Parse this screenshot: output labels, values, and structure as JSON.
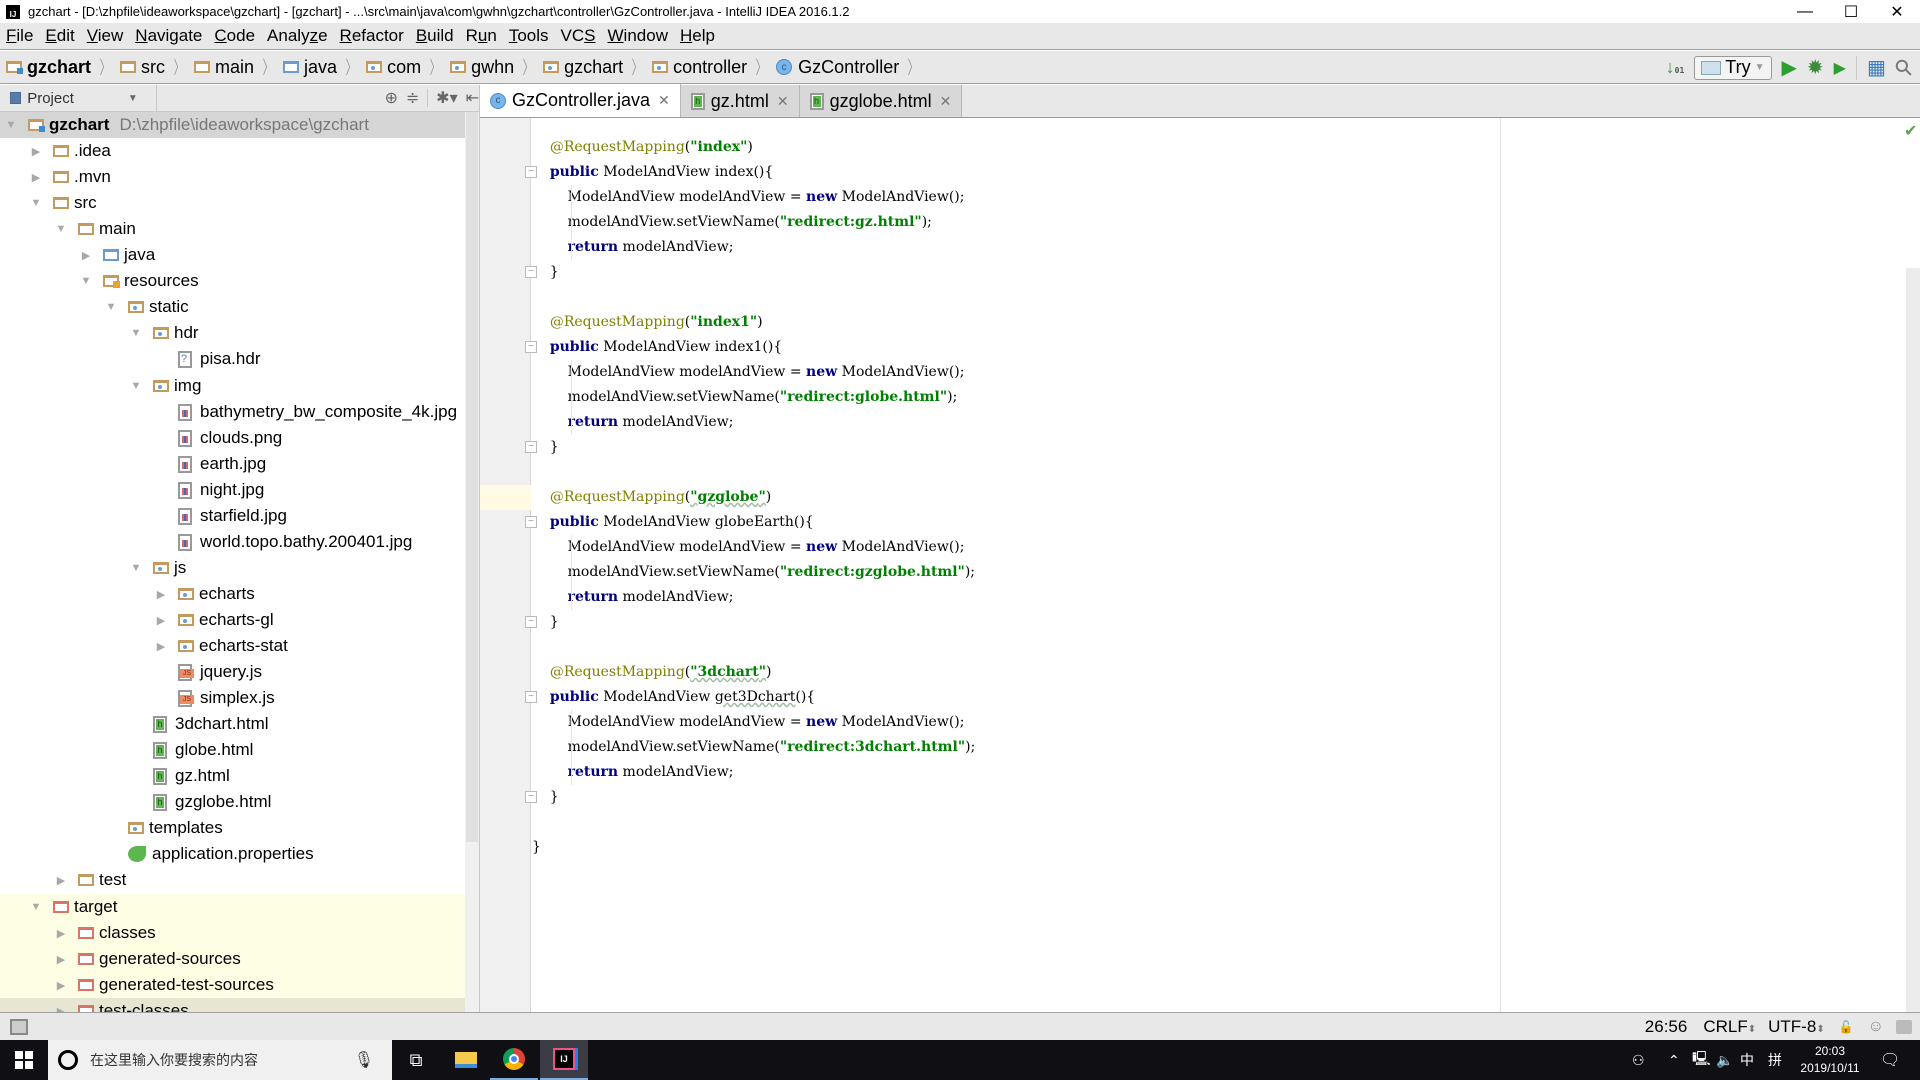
{
  "window": {
    "title": "gzchart - [D:\\zhpfile\\ideaworkspace\\gzchart] - [gzchart] - ...\\src\\main\\java\\com\\gwhn\\gzchart\\controller\\GzController.java - IntelliJ IDEA 2016.1.2",
    "app_icon": "IJ",
    "minimize_glyph": "—",
    "maximize_glyph": "☐",
    "close_glyph": "✕"
  },
  "menu": [
    {
      "u": "F",
      "rest": "ile"
    },
    {
      "u": "E",
      "rest": "dit"
    },
    {
      "u": "V",
      "rest": "iew"
    },
    {
      "u": "N",
      "rest": "avigate"
    },
    {
      "u": "C",
      "rest": "ode"
    },
    {
      "pre": "Analy",
      "u": "z",
      "rest": "e"
    },
    {
      "u": "R",
      "rest": "efactor"
    },
    {
      "u": "B",
      "rest": "uild"
    },
    {
      "pre": "R",
      "u": "u",
      "rest": "n"
    },
    {
      "u": "T",
      "rest": "ools"
    },
    {
      "pre": "VC",
      "u": "S",
      "rest": ""
    },
    {
      "u": "W",
      "rest": "indow"
    },
    {
      "u": "H",
      "rest": "elp"
    }
  ],
  "breadcrumb": [
    "gzchart",
    "src",
    "main",
    "java",
    "com",
    "gwhn",
    "gzchart",
    "controller",
    "GzController"
  ],
  "toolbar": {
    "run_config": "Try",
    "run_icon": "▶",
    "debug_icon": "✹",
    "coverage_icon": "▶",
    "structure_icon": "▦",
    "search_icon": "⚲"
  },
  "project_panel": {
    "title": "Project",
    "root_name": "gzchart",
    "root_path": "D:\\zhpfile\\ideaworkspace\\gzchart",
    "items": [
      {
        "label": ".idea",
        "depth": 1,
        "type": "folder",
        "expanded": false
      },
      {
        "label": ".mvn",
        "depth": 1,
        "type": "folder",
        "expanded": false
      },
      {
        "label": "src",
        "depth": 1,
        "type": "folder",
        "expanded": true
      },
      {
        "label": "main",
        "depth": 2,
        "type": "folder",
        "expanded": true
      },
      {
        "label": "java",
        "depth": 3,
        "type": "folder-source",
        "expanded": false
      },
      {
        "label": "resources",
        "depth": 3,
        "type": "folder-resources",
        "expanded": true
      },
      {
        "label": "static",
        "depth": 4,
        "type": "folder-package",
        "expanded": true
      },
      {
        "label": "hdr",
        "depth": 5,
        "type": "folder-package",
        "expanded": true
      },
      {
        "label": "pisa.hdr",
        "depth": 6,
        "type": "file-unknown"
      },
      {
        "label": "img",
        "depth": 5,
        "type": "folder-package",
        "expanded": true
      },
      {
        "label": "bathymetry_bw_composite_4k.jpg",
        "depth": 6,
        "type": "file-image"
      },
      {
        "label": "clouds.png",
        "depth": 6,
        "type": "file-image"
      },
      {
        "label": "earth.jpg",
        "depth": 6,
        "type": "file-image"
      },
      {
        "label": "night.jpg",
        "depth": 6,
        "type": "file-image"
      },
      {
        "label": "starfield.jpg",
        "depth": 6,
        "type": "file-image"
      },
      {
        "label": "world.topo.bathy.200401.jpg",
        "depth": 6,
        "type": "file-image"
      },
      {
        "label": "js",
        "depth": 5,
        "type": "folder-package",
        "expanded": true
      },
      {
        "label": "echarts",
        "depth": 6,
        "type": "folder-package",
        "expanded": false
      },
      {
        "label": "echarts-gl",
        "depth": 6,
        "type": "folder-package",
        "expanded": false
      },
      {
        "label": "echarts-stat",
        "depth": 6,
        "type": "folder-package",
        "expanded": false
      },
      {
        "label": "jquery.js",
        "depth": 6,
        "type": "file-js"
      },
      {
        "label": "simplex.js",
        "depth": 6,
        "type": "file-js"
      },
      {
        "label": "3dchart.html",
        "depth": 5,
        "type": "file-html"
      },
      {
        "label": "globe.html",
        "depth": 5,
        "type": "file-html"
      },
      {
        "label": "gz.html",
        "depth": 5,
        "type": "file-html"
      },
      {
        "label": "gzglobe.html",
        "depth": 5,
        "type": "file-html"
      },
      {
        "label": "templates",
        "depth": 4,
        "type": "folder-package"
      },
      {
        "label": "application.properties",
        "depth": 4,
        "type": "file-spring"
      },
      {
        "label": "test",
        "depth": 2,
        "type": "folder",
        "expanded": false
      },
      {
        "label": "target",
        "depth": 1,
        "type": "folder-excluded",
        "expanded": true
      },
      {
        "label": "classes",
        "depth": 2,
        "type": "folder-excluded",
        "expanded": false
      },
      {
        "label": "generated-sources",
        "depth": 2,
        "type": "folder-excluded",
        "expanded": false
      },
      {
        "label": "generated-test-sources",
        "depth": 2,
        "type": "folder-excluded",
        "expanded": false
      },
      {
        "label": "test-classes",
        "depth": 2,
        "type": "folder-excluded",
        "expanded": false
      }
    ]
  },
  "editor_tabs": [
    {
      "label": "GzController.java",
      "icon": "class",
      "active": true
    },
    {
      "label": "gz.html",
      "icon": "html",
      "active": false
    },
    {
      "label": "gzglobe.html",
      "icon": "html",
      "active": false
    }
  ],
  "code": {
    "blocks": [
      {
        "mapping": "index",
        "method": "index",
        "target": "redirect:gz.html",
        "wavy_mapping": false,
        "wavy_method": false,
        "wavy_target": false
      },
      {
        "mapping": "index1",
        "method": "index1",
        "target": "redirect:globe.html",
        "wavy_mapping": false,
        "wavy_method": false,
        "wavy_target": false
      },
      {
        "mapping": "gzglobe",
        "method": "globeEarth",
        "target": "redirect:gzglobe.html",
        "wavy_mapping": true,
        "wavy_method": false,
        "wavy_target": true
      },
      {
        "mapping": "3dchart",
        "method": "get3Dchart",
        "target": "redirect:3dchart.html",
        "wavy_mapping": true,
        "wavy_method": true,
        "wavy_target": true
      }
    ],
    "annotation": "@RequestMapping",
    "kw_public": "public",
    "type": "ModelAndView",
    "kw_new": "new",
    "kw_return": "return",
    "var": "modelAndView",
    "setter": "setViewName",
    "highlighted_line": 14
  },
  "statusbar": {
    "position": "26:56",
    "line_sep": "CRLF",
    "encoding": "UTF-8"
  },
  "taskbar": {
    "search_placeholder": "在这里输入你要搜索的内容",
    "time": "20:03",
    "date": "2019/10/11",
    "ime_lang": "中",
    "ime_mode": "拼"
  }
}
